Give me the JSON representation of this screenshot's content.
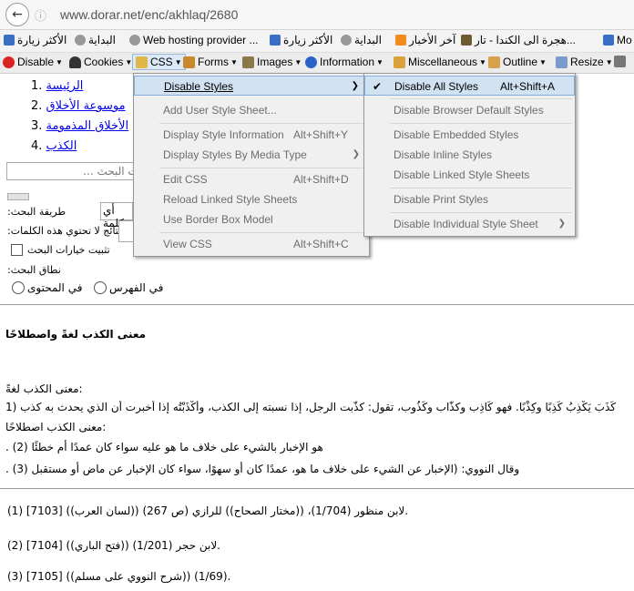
{
  "browser": {
    "url": "www.dorar.net/enc/akhlaq/2680",
    "bookmarks": [
      "الأكثر زيارة",
      "البداية",
      "Web hosting provider ...",
      "الأكثر زيارة",
      "البداية",
      "آخر الأخبار",
      "هجرة الى الكندا - تار...",
      "Mo"
    ],
    "devtools": [
      "Disable",
      "Cookies",
      "CSS",
      "Forms",
      "Images",
      "Information",
      "Miscellaneous",
      "Outline",
      "Resize"
    ]
  },
  "page": {
    "nav": [
      "الرئيسة",
      "موسوعة الأخلاق",
      "الأخلاق المذمومة",
      "الكذب"
    ],
    "search_placeholder": "... كلمات البحث",
    "search_method_label": ":طريقة البحث",
    "search_method_value": "أي كلمة",
    "exclude_label": ":النتائج لا تحتوي هذه الكلمات",
    "fix_options_label": "تثبيت خيارات البحث",
    "scope_label": ":نطاق البحث",
    "scope_index": "في الفهرس",
    "scope_content": "في المحتوى",
    "heading": "معنى الكذب لغةً واصطلاحًا",
    "lang_title": ":معنى الكذب لغةً",
    "lang_text": "كَذَبَ يَكْذِبُ كَذِبًا وكِذْبًا. فهو كَاذِب وكذَّاب وكَذُوب، تقول: كذَّبت الرجل، إذا نسبته إلى الكذب، وأَكْذَبْتُه إذا أخبرت أن الذي يحدث به كذب (1",
    "term_title": ":معنى الكذب اصطلاحًا",
    "term_text": ". (هو الإخبار بالشيء على خلاف ما هو عليه سواء كان عمدًا أم خطئًا (2",
    "nawawi_text": ". (وقال النووي: (الإخبار عن الشيء على خلاف ما هو، عمدًا كان أو سهوًا، سواء كان الإخبار عن ماض أو مستقبل (3",
    "footnotes": [
      "(1) [7103] ((لسان العرب)) لابن منظور (1/704)، ((مختار الصحاح)) للرازي (ص 267).",
      "(2) [7104] ((فتح الباري)) لابن حجر (1/201).",
      "(3) [7105] ((شرح النووي على مسلم)) (1/69)."
    ]
  },
  "css_menu": {
    "items": [
      {
        "label": "Disable Styles",
        "shortcut": "",
        "submenu": true
      },
      {
        "label": "Add User Style Sheet...",
        "shortcut": ""
      },
      {
        "label": "Display Style Information",
        "shortcut": "Alt+Shift+Y"
      },
      {
        "label": "Display Styles By Media Type",
        "shortcut": "",
        "submenu": true
      },
      {
        "label": "Edit CSS",
        "shortcut": "Alt+Shift+D"
      },
      {
        "label": "Reload Linked Style Sheets",
        "shortcut": ""
      },
      {
        "label": "Use Border Box Model",
        "shortcut": ""
      },
      {
        "label": "View CSS",
        "shortcut": "Alt+Shift+C"
      }
    ]
  },
  "disable_submenu": {
    "items": [
      {
        "label": "Disable All Styles",
        "shortcut": "Alt+Shift+A",
        "checked": true
      },
      {
        "label": "Disable Browser Default Styles",
        "shortcut": ""
      },
      {
        "label": "Disable Embedded Styles",
        "shortcut": ""
      },
      {
        "label": "Disable Inline Styles",
        "shortcut": ""
      },
      {
        "label": "Disable Linked Style Sheets",
        "shortcut": ""
      },
      {
        "label": "Disable Print Styles",
        "shortcut": ""
      },
      {
        "label": "Disable Individual Style Sheet",
        "shortcut": "",
        "submenu": true
      }
    ]
  },
  "colors": {
    "highlight": "#d1e2f2",
    "link": "#0000ee",
    "menu_bg": "#f0f0f0"
  }
}
